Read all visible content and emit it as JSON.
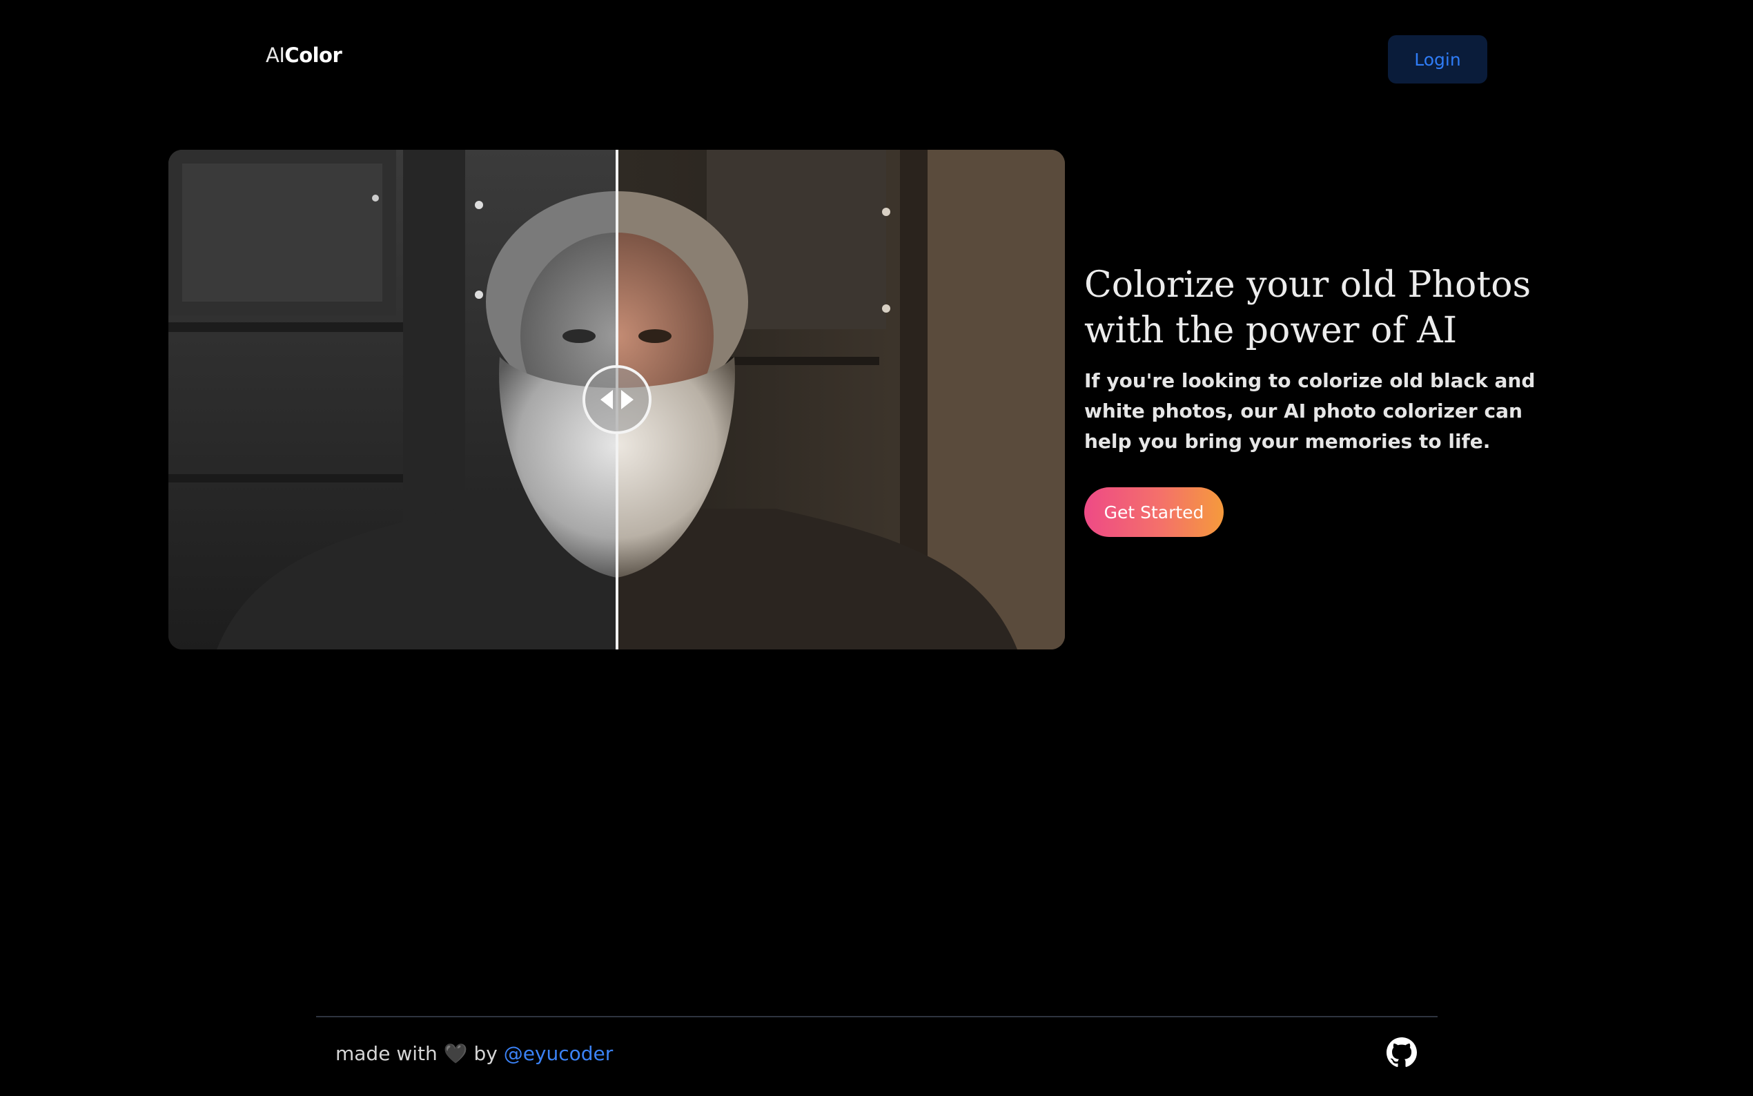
{
  "header": {
    "logo_prefix": "AI",
    "logo_main": "Color",
    "login_label": "Login"
  },
  "hero": {
    "title": "Colorize your old Photos with the power of AI",
    "description": "If you're looking to colorize old black and white photos, our AI photo colorizer can help you bring your memories to life.",
    "cta_label": "Get Started"
  },
  "comparison": {
    "left_label": "black-and-white original",
    "right_label": "colorized result",
    "slider_position": 0.5,
    "handle_icon": "left-right-arrows-icon"
  },
  "footer": {
    "made_with": "made with",
    "heart": "🖤",
    "by": "by",
    "author_link": "@eyucoder",
    "github_icon": "github-icon"
  },
  "colors": {
    "background": "#000000",
    "login_bg": "#0a1c3a",
    "login_text": "#2f7cf6",
    "cta_gradient_start": "#ee4a86",
    "cta_gradient_end": "#f59a3c",
    "link": "#3b82f6"
  }
}
